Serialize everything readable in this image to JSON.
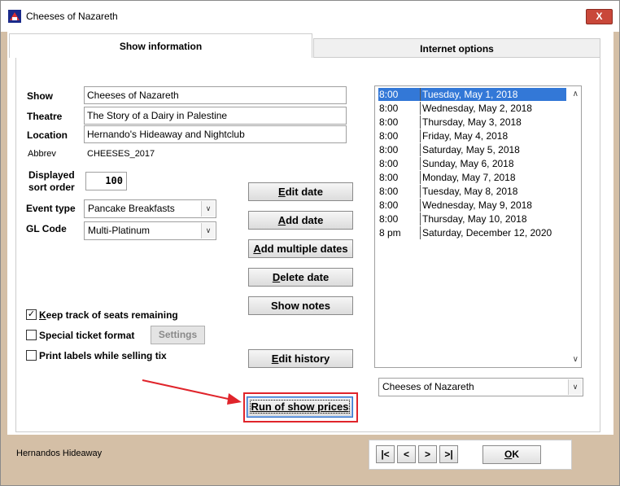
{
  "window": {
    "title": "Cheeses of Nazareth",
    "close_label": "X"
  },
  "tabs": [
    {
      "label": "Show information",
      "active": true
    },
    {
      "label": "Internet options",
      "active": false
    }
  ],
  "form": {
    "show_label": "Show",
    "show_value": "Cheeses of Nazareth",
    "theatre_label": "Theatre",
    "theatre_value": "The Story of a Dairy in Palestine",
    "location_label": "Location",
    "location_value": "Hernando's Hideaway and Nightclub",
    "abbrev_label": "Abbrev",
    "abbrev_value": "CHEESES_2017",
    "sort_label_1": "Displayed",
    "sort_label_2": "sort order",
    "sort_value": "100",
    "event_type_label": "Event type",
    "event_type_value": "Pancake Breakfasts",
    "gl_code_label": "GL Code",
    "gl_code_value": "Multi-Platinum"
  },
  "buttons": {
    "edit_date_u": "E",
    "edit_date_rest": "dit date",
    "add_date_u": "A",
    "add_date_rest": "dd date",
    "add_multiple_u": "A",
    "add_multiple_rest": "dd multiple dates",
    "delete_date_u": "D",
    "delete_date_rest": "elete date",
    "show_notes": "Show notes",
    "edit_history_u": "E",
    "edit_history_rest": "dit history",
    "run_of_show_u": "R",
    "run_of_show_rest": "un of show prices",
    "settings": "Settings",
    "ok_u": "O",
    "ok_rest": "K"
  },
  "checkboxes": [
    {
      "label_u": "K",
      "label_rest": "eep track of seats remaining",
      "checked": true
    },
    {
      "label_u": "",
      "label_rest": "Special ticket format",
      "checked": false
    },
    {
      "label_u": "",
      "label_rest": "Print labels while selling tix",
      "checked": false
    }
  ],
  "dates": [
    {
      "time": "8:00",
      "date": "Tuesday, May 1, 2018",
      "selected": true
    },
    {
      "time": "8:00",
      "date": "Wednesday, May 2, 2018",
      "selected": false
    },
    {
      "time": "8:00",
      "date": "Thursday, May 3, 2018",
      "selected": false
    },
    {
      "time": "8:00",
      "date": "Friday, May 4, 2018",
      "selected": false
    },
    {
      "time": "8:00",
      "date": "Saturday, May 5, 2018",
      "selected": false
    },
    {
      "time": "8:00",
      "date": "Sunday, May 6, 2018",
      "selected": false
    },
    {
      "time": "8:00",
      "date": "Monday, May 7, 2018",
      "selected": false
    },
    {
      "time": "8:00",
      "date": "Tuesday, May 8, 2018",
      "selected": false
    },
    {
      "time": "8:00",
      "date": "Wednesday, May 9, 2018",
      "selected": false
    },
    {
      "time": "8:00",
      "date": "Thursday, May 10, 2018",
      "selected": false
    },
    {
      "time": "8 pm",
      "date": "Saturday, December 12, 2020",
      "selected": false
    }
  ],
  "show_select_value": "Cheeses of Nazareth",
  "status_text": "Hernandos Hideaway",
  "nav": {
    "first": "|<",
    "prev": "<",
    "next": ">",
    "last": ">|"
  },
  "icons": {
    "window_icon": "theatre-icon",
    "dropdown": "chevron-down-icon",
    "scroll_up": "chevron-up-icon",
    "scroll_down": "chevron-down-icon"
  },
  "colors": {
    "frame": "#d4bfa6",
    "selection": "#3378d7",
    "highlight": "#e0242b",
    "close": "#c9483a"
  }
}
